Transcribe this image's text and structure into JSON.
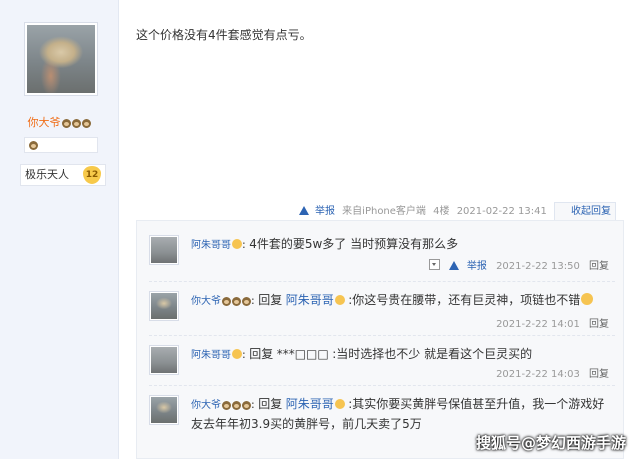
{
  "user": {
    "name": "你大爷",
    "rank_name": "极乐天人",
    "rank_level": "12"
  },
  "post": {
    "text": "这个价格没有4件套感觉有点亏。",
    "report_label": "举报",
    "source": "来自iPhone客户端",
    "floor": "4楼",
    "time": "2021-02-22 13:41",
    "collapse_label": "收起回复"
  },
  "replies": [
    {
      "author": "阿朱哥哥",
      "content": "4件套的要5w多了 当时预算没有那么多",
      "report_label": "举报",
      "time": "2021-2-22 13:50",
      "reply_label": "回复"
    },
    {
      "author": "你大爷",
      "prefix": "回复",
      "target": "阿朱哥哥",
      "content": ":你这号贵在腰带，还有巨灵神，项链也不错",
      "time": "2021-2-22 14:01",
      "reply_label": "回复"
    },
    {
      "author": "阿朱哥哥",
      "prefix": "回复",
      "target": "***□□□",
      "content": ":当时选择也不少 就是看这个巨灵买的",
      "time": "2021-2-22 14:03",
      "reply_label": "回复"
    },
    {
      "author": "你大爷",
      "prefix": "回复",
      "target": "阿朱哥哥",
      "content": ":其实你要买黄胖号保值甚至升值，我一个游戏好友去年年初3.9买的黄胖号，前几天卖了5万"
    }
  ],
  "watermark": "搜狐号@梦幻西游手游",
  "colors": {
    "link": "#2d64b3",
    "username": "#f06e19",
    "sidebar_bg": "#f1f4fb"
  }
}
